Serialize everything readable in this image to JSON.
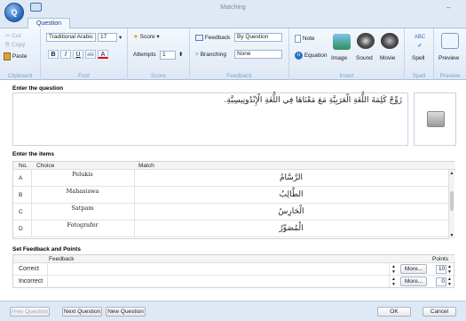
{
  "window": {
    "title": "Matching",
    "minimize_glyph": "–"
  },
  "tabs": {
    "question": "Question"
  },
  "ribbon": {
    "clipboard": {
      "cut": "Cut",
      "copy": "Copy",
      "paste": "Paste",
      "label": "Clipboard"
    },
    "font": {
      "family": "Traditional Arabic",
      "size": "17",
      "bold": "B",
      "italic": "I",
      "underline": "U",
      "strike": "ab",
      "color": "A",
      "label": "Font"
    },
    "score": {
      "score": "Score",
      "attempts_label": "Attempts",
      "attempts": "1",
      "label": "Score"
    },
    "feedback": {
      "feedback": "Feedback",
      "feedback_value": "By Question",
      "branching": "Branching",
      "branching_value": "None",
      "label": "Feedback"
    },
    "insert": {
      "note": "Note",
      "equation": "Equation",
      "image": "Image",
      "sound": "Sound",
      "movie": "Movie",
      "label": "Insert"
    },
    "spell": {
      "spell": "Spell",
      "label": "Spell"
    },
    "preview": {
      "preview": "Preview",
      "label": "Preview"
    }
  },
  "question": {
    "heading": "Enter the question",
    "text": "زَوِّجْ كَلِمَةَ اللُّغَةِ الْعَرَبِيَّةِ مَعَ مَعْنَاهَا فِي اللُّغَةِ الْإِنْدُونِيسِيَّةِ."
  },
  "items": {
    "heading": "Enter the items",
    "columns": [
      "No.",
      "Choice",
      "Match"
    ],
    "rows": [
      {
        "no": "A",
        "choice": "Pelukis",
        "match": "الرَّسَّامُ"
      },
      {
        "no": "B",
        "choice": "Mahasiswa",
        "match": "الطَّالِبُ"
      },
      {
        "no": "C",
        "choice": "Satpam",
        "match": "الْحَارِسُ"
      },
      {
        "no": "D",
        "choice": "Fotografer",
        "match": "الْمُصَوِّرُ"
      }
    ]
  },
  "feedback_points": {
    "heading": "Set Feedback and Points",
    "columns": {
      "feedback": "Feedback",
      "points": "Points"
    },
    "rows": [
      {
        "label": "Correct",
        "more": "More...",
        "points": "10"
      },
      {
        "label": "Incorrect",
        "more": "More...",
        "points": "0"
      }
    ]
  },
  "bottom": {
    "prev": "Prev Question",
    "next": "Next Question",
    "new": "New Question",
    "ok": "OK",
    "cancel": "Cancel"
  },
  "colors": {
    "accent": "#15428b",
    "ribbon": "#dde8f5",
    "frame": "#dfe9f5"
  }
}
